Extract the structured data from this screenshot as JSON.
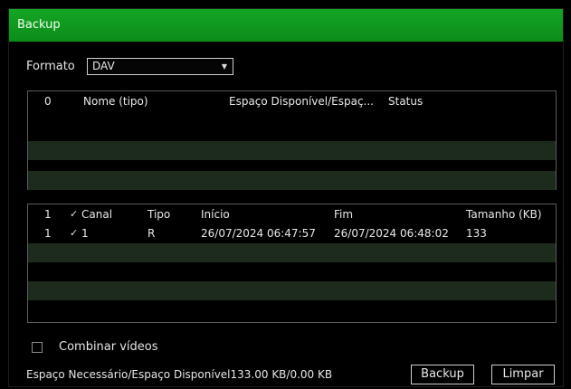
{
  "window": {
    "title": "Backup"
  },
  "format": {
    "label": "Formato",
    "value": "DAV"
  },
  "files_table": {
    "headers": [
      "0",
      "Nome (tipo)",
      "Espaço Disponível/Espaç...",
      "Status"
    ]
  },
  "records_table": {
    "headers": {
      "index": "1",
      "channel": "Canal",
      "type": "Tipo",
      "start": "Início",
      "end": "Fim",
      "size": "Tamanho (KB)"
    },
    "rows": [
      {
        "index": "1",
        "channel": "1",
        "type": "R",
        "start": "26/07/2024 06:47:57",
        "end": "26/07/2024 06:48:02",
        "size": "133"
      }
    ]
  },
  "combine": {
    "label": "Combinar vídeos"
  },
  "footer": {
    "space_text": "Espaço Necessário/Espaço Disponível133.00 KB/0.00 KB",
    "backup_label": "Backup",
    "clear_label": "Limpar"
  },
  "colors": {
    "titlebar": "#0f9a1f",
    "stripe": "#1d2b1d"
  }
}
